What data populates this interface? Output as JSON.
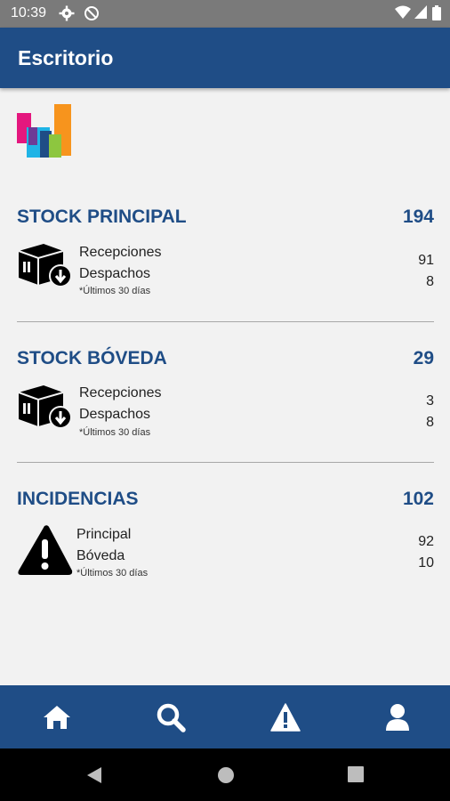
{
  "status_bar": {
    "time": "10:39",
    "icons": [
      "gear-icon",
      "do-not-disturb-icon",
      "wifi-icon",
      "signal-icon",
      "battery-icon"
    ]
  },
  "app_bar": {
    "title": "Escritorio"
  },
  "colors": {
    "primary": "#1f4d86",
    "background": "#f2f2f2"
  },
  "sections": [
    {
      "title": "STOCK PRINCIPAL",
      "total": "194",
      "icon": "box-download-icon",
      "rows": [
        {
          "label": "Recepciones",
          "value": "91"
        },
        {
          "label": "Despachos",
          "value": "8"
        }
      ],
      "note": "*Últimos 30 días"
    },
    {
      "title": "STOCK BÓVEDA",
      "total": "29",
      "icon": "box-download-icon",
      "rows": [
        {
          "label": "Recepciones",
          "value": "3"
        },
        {
          "label": "Despachos",
          "value": "8"
        }
      ],
      "note": "*Últimos 30 días"
    },
    {
      "title": "INCIDENCIAS",
      "total": "102",
      "icon": "warning-icon",
      "rows": [
        {
          "label": "Principal",
          "value": "92"
        },
        {
          "label": "Bóveda",
          "value": "10"
        }
      ],
      "note": "*Últimos 30 días"
    }
  ],
  "bottom_nav": [
    "home-icon",
    "search-icon",
    "alert-icon",
    "user-icon"
  ],
  "system_nav": [
    "back-icon",
    "home-circle-icon",
    "recents-icon"
  ]
}
